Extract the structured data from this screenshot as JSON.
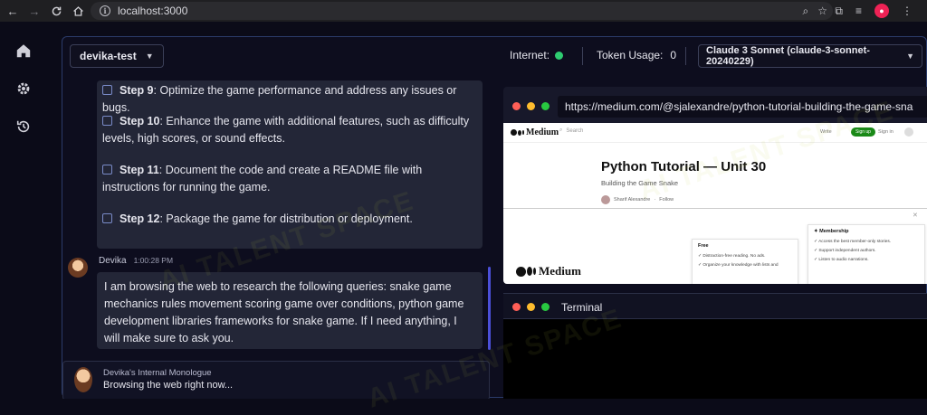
{
  "browser": {
    "url": "localhost:3000"
  },
  "app": {
    "project": "devika-test",
    "internet_label": "Internet:",
    "token_label": "Token Usage:",
    "token_value": "0",
    "model": "Claude 3 Sonnet (claude-3-sonnet-20240229)"
  },
  "steps": [
    {
      "num": "Step 9",
      "text": ": Optimize the game performance and address any issues or bugs."
    },
    {
      "num": "Step 10",
      "text": ": Enhance the game with additional features, such as difficulty levels, high scores, or sound effects."
    },
    {
      "num": "Step 11",
      "text": ": Document the code and create a README file with instructions for running the game."
    },
    {
      "num": "Step 12",
      "text": ": Package the game for distribution or deployment."
    }
  ],
  "message": {
    "author": "Devika",
    "time": "1:00:28 PM",
    "text": "I am browsing the web to research the following queries: snake game mechanics rules movement scoring game over conditions, python game development libraries frameworks for snake game. If I need anything, I will make sure to ask you."
  },
  "monologue": {
    "title": "Devika's Internal Monologue",
    "text": "Browsing the web right now..."
  },
  "browser_panel": {
    "url": "https://medium.com/@sjalexandre/python-tutorial-building-the-game-sna",
    "page": {
      "logo": "Medium",
      "search_placeholder": "Search",
      "write": "Write",
      "signup": "Sign up",
      "signin": "Sign in",
      "title": "Python Tutorial — Unit 30",
      "subtitle": "Building the Game Snake",
      "author": "Sharif Alexandre",
      "follow": "Follow",
      "free_title": "Free",
      "free_items": [
        "Distraction-free reading. No ads.",
        "Organize your knowledge with lists and"
      ],
      "member_title": "Membership",
      "member_items": [
        "Access the best member-only stories.",
        "Support independent authors.",
        "Listen to audio narrations."
      ]
    }
  },
  "terminal": {
    "title": "Terminal"
  },
  "watermark": "AI TALENT SPACE",
  "colors": {
    "accent": "#4b4fd8",
    "status_ok": "#2ecc71",
    "medium_green": "#1a8917"
  }
}
